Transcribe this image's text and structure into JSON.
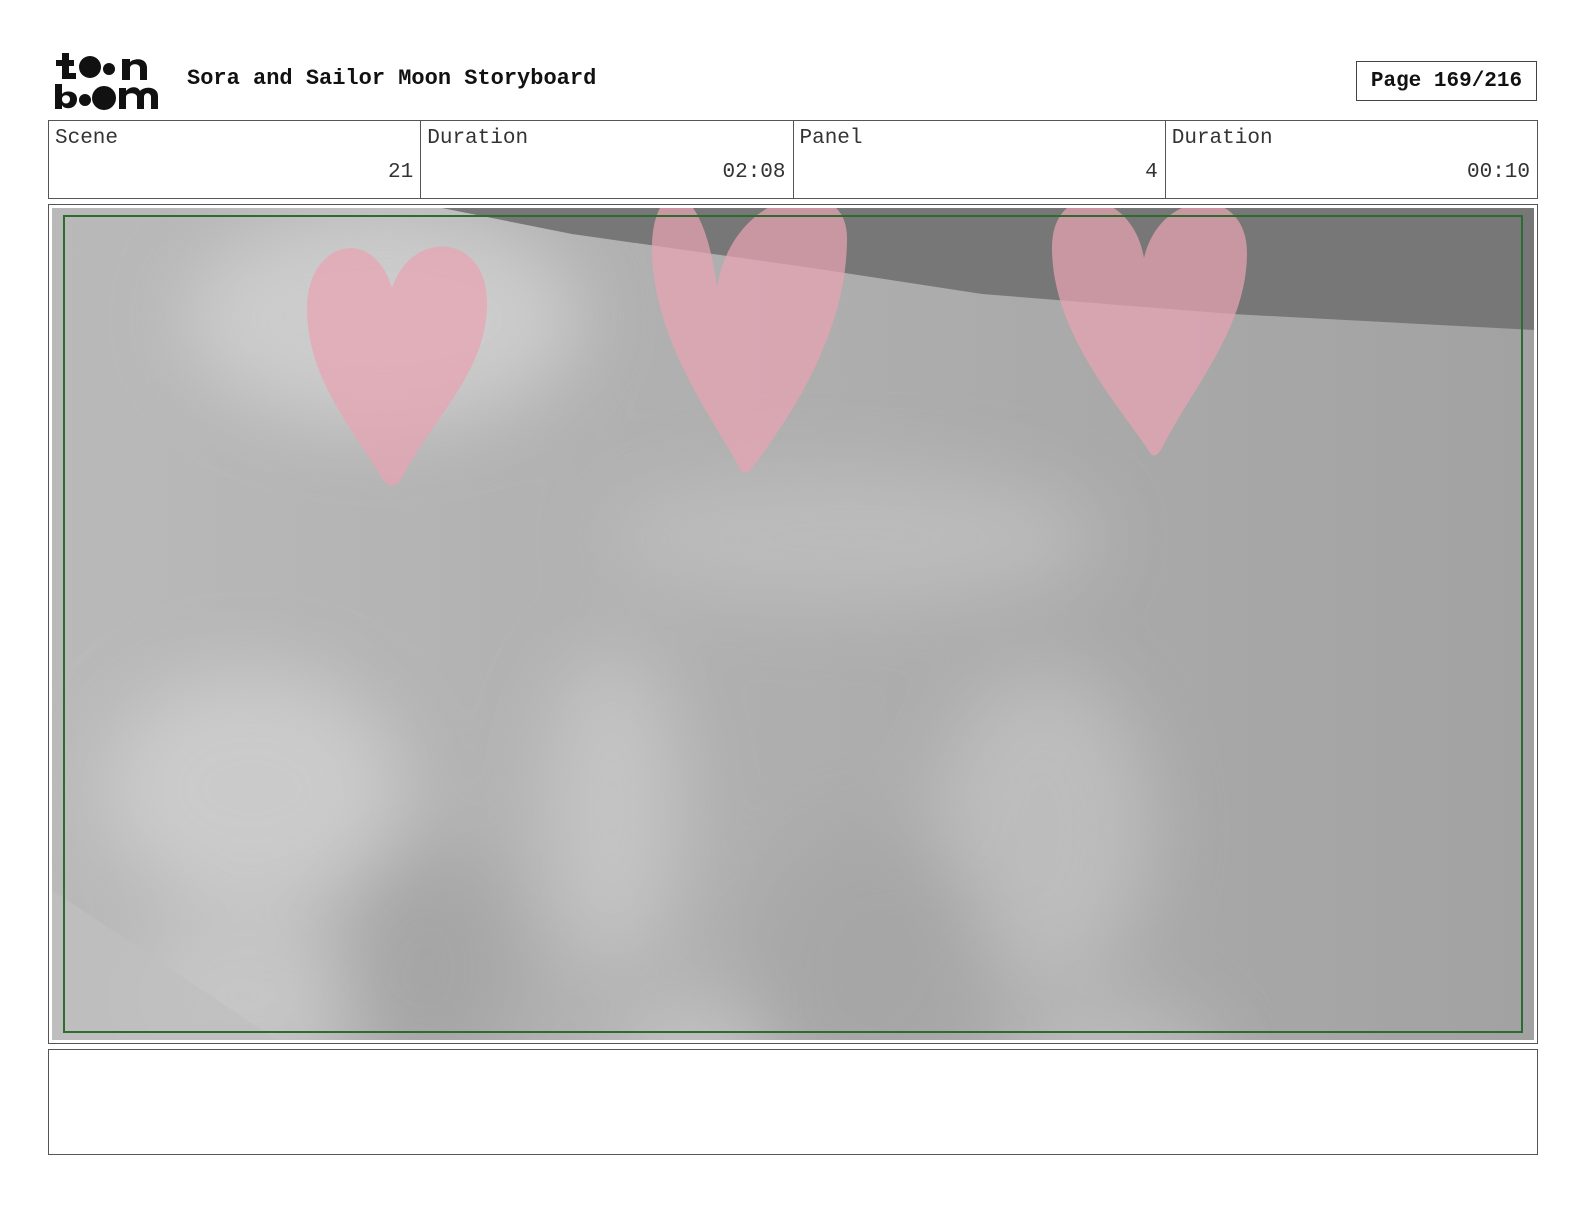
{
  "header": {
    "logo_line1": "toon",
    "logo_line2": "boom",
    "title": "Sora and Sailor Moon Storyboard",
    "page": "Page 169/216"
  },
  "info": {
    "scene_label": "Scene",
    "scene_value": "21",
    "scene_duration_label": "Duration",
    "scene_duration_value": "02:08",
    "panel_label": "Panel",
    "panel_value": "4",
    "panel_duration_label": "Duration",
    "panel_duration_value": "00:10"
  },
  "panel": {
    "heart_color": "#e8a3b3",
    "safe_area_color": "#2e6b2e",
    "background_color": "#a9a9a9"
  },
  "notes": {
    "text": ""
  }
}
